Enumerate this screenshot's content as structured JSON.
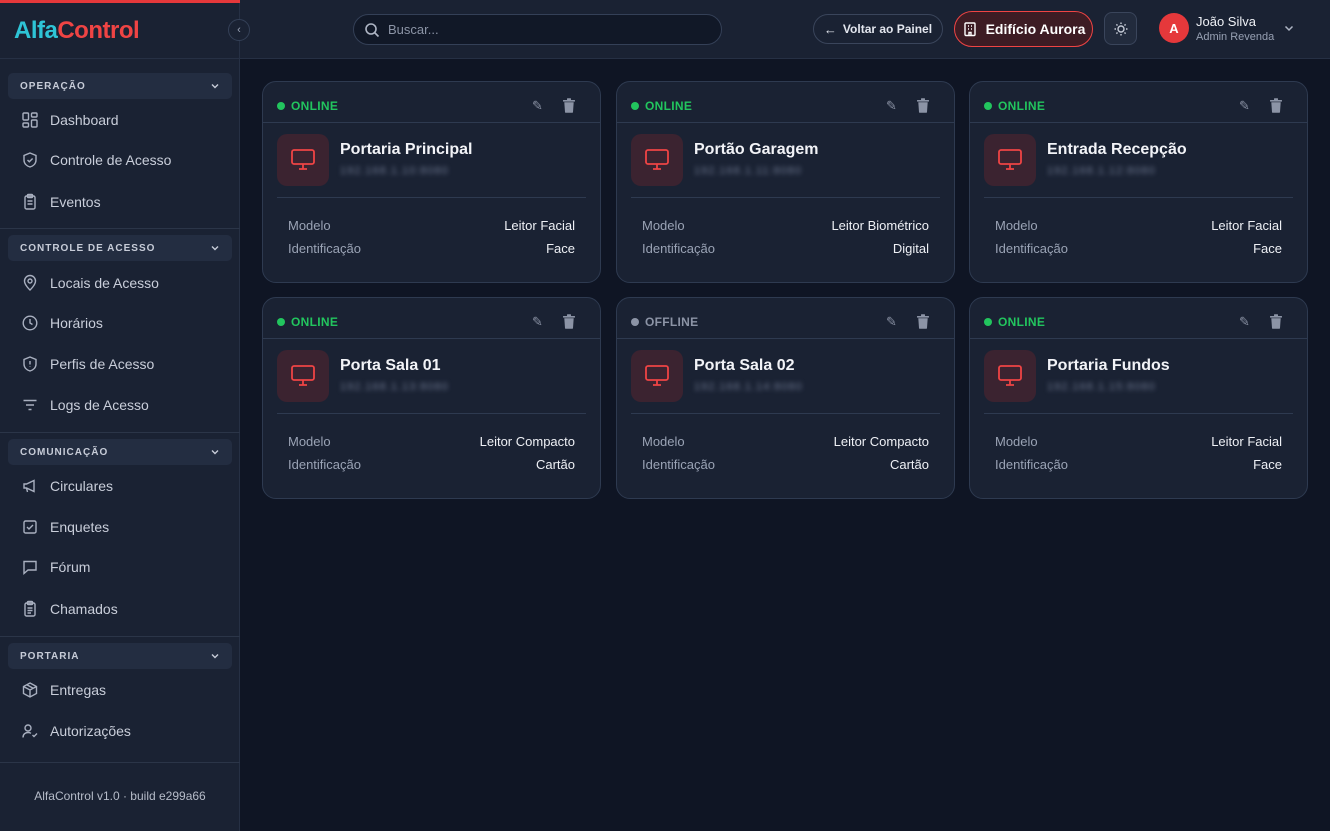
{
  "brand": {
    "part1": "Alfa",
    "part2": "Control"
  },
  "sidebar": {
    "sections": [
      {
        "title": "OPERAÇÃO",
        "items": [
          {
            "label": "Dashboard",
            "icon": "grid-icon"
          },
          {
            "label": "Controle de Acesso",
            "icon": "shield-check-icon"
          },
          {
            "label": "Eventos",
            "icon": "clipboard-icon"
          }
        ]
      },
      {
        "title": "CONTROLE DE ACESSO",
        "items": [
          {
            "label": "Locais de Acesso",
            "icon": "map-pin-icon"
          },
          {
            "label": "Horários",
            "icon": "clock-icon"
          },
          {
            "label": "Perfis de Acesso",
            "icon": "shield-alert-icon"
          },
          {
            "label": "Logs de Acesso",
            "icon": "filter-icon"
          }
        ]
      },
      {
        "title": "COMUNICAÇÃO",
        "items": [
          {
            "label": "Circulares",
            "icon": "megaphone-icon"
          },
          {
            "label": "Enquetes",
            "icon": "poll-icon"
          },
          {
            "label": "Fórum",
            "icon": "chat-icon"
          },
          {
            "label": "Chamados",
            "icon": "clipboard-list-icon"
          }
        ]
      },
      {
        "title": "PORTARIA",
        "items": [
          {
            "label": "Entregas",
            "icon": "package-icon"
          },
          {
            "label": "Autorizações",
            "icon": "user-check-icon"
          }
        ]
      }
    ],
    "footer": "AlfaControl v1.0 · build e299a66"
  },
  "header": {
    "search_placeholder": "Buscar...",
    "back_label": "Voltar ao Painel",
    "building_label": "Edifício Aurora",
    "user": {
      "initial": "A",
      "name": "João Silva",
      "role": "Admin Revenda"
    }
  },
  "labels": {
    "model": "Modelo",
    "identification": "Identificação"
  },
  "devices": [
    {
      "status": "ONLINE",
      "name": "Portaria Principal",
      "ip": "192.168.1.10:8080",
      "model": "Leitor Facial",
      "identification": "Face"
    },
    {
      "status": "ONLINE",
      "name": "Portão Garagem",
      "ip": "192.168.1.11:8080",
      "model": "Leitor Biométrico",
      "identification": "Digital"
    },
    {
      "status": "ONLINE",
      "name": "Entrada Recepção",
      "ip": "192.168.1.12:8080",
      "model": "Leitor Facial",
      "identification": "Face"
    },
    {
      "status": "ONLINE",
      "name": "Porta Sala 01",
      "ip": "192.168.1.13:8080",
      "model": "Leitor Compacto",
      "identification": "Cartão"
    },
    {
      "status": "OFFLINE",
      "name": "Porta Sala 02",
      "ip": "192.168.1.14:8080",
      "model": "Leitor Compacto",
      "identification": "Cartão"
    },
    {
      "status": "ONLINE",
      "name": "Portaria Fundos",
      "ip": "192.168.1.15:8080",
      "model": "Leitor Facial",
      "identification": "Face"
    }
  ],
  "colors": {
    "accent": "#ef4444",
    "online": "#22c55e",
    "offline": "#8c94a6",
    "brand_cyan": "#2ec4d6"
  }
}
